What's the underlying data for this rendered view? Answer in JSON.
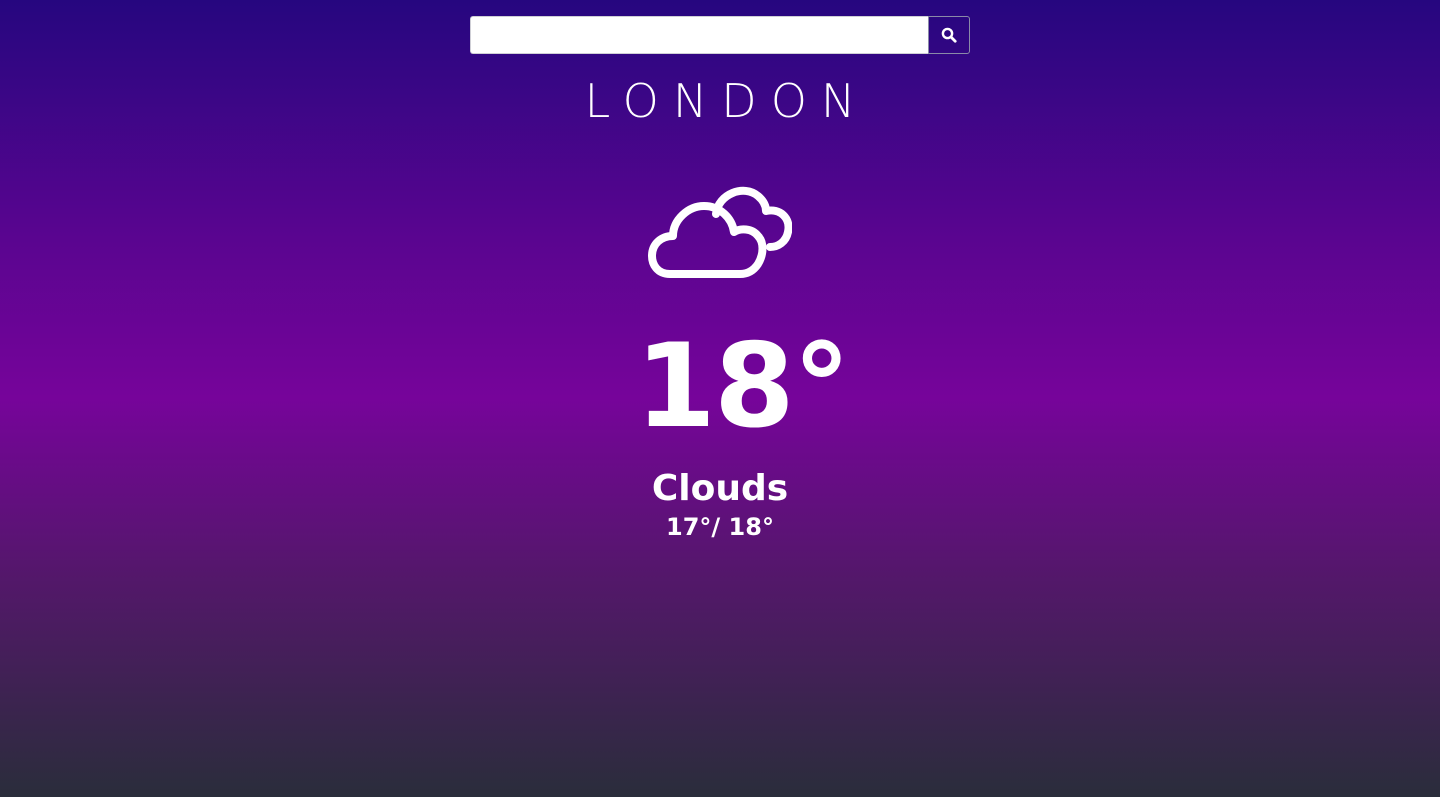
{
  "search": {
    "value": "",
    "placeholder": "",
    "button_icon": "search-icon"
  },
  "weather": {
    "city": "LONDON",
    "icon": "clouds-icon",
    "temperature": "18°",
    "condition": "Clouds",
    "min_max": "17°/ 18°"
  },
  "colors": {
    "gradient_top": "#26067f",
    "gradient_middle": "#76049a",
    "gradient_bottom": "#2a2d3b",
    "text": "#ffffff"
  }
}
